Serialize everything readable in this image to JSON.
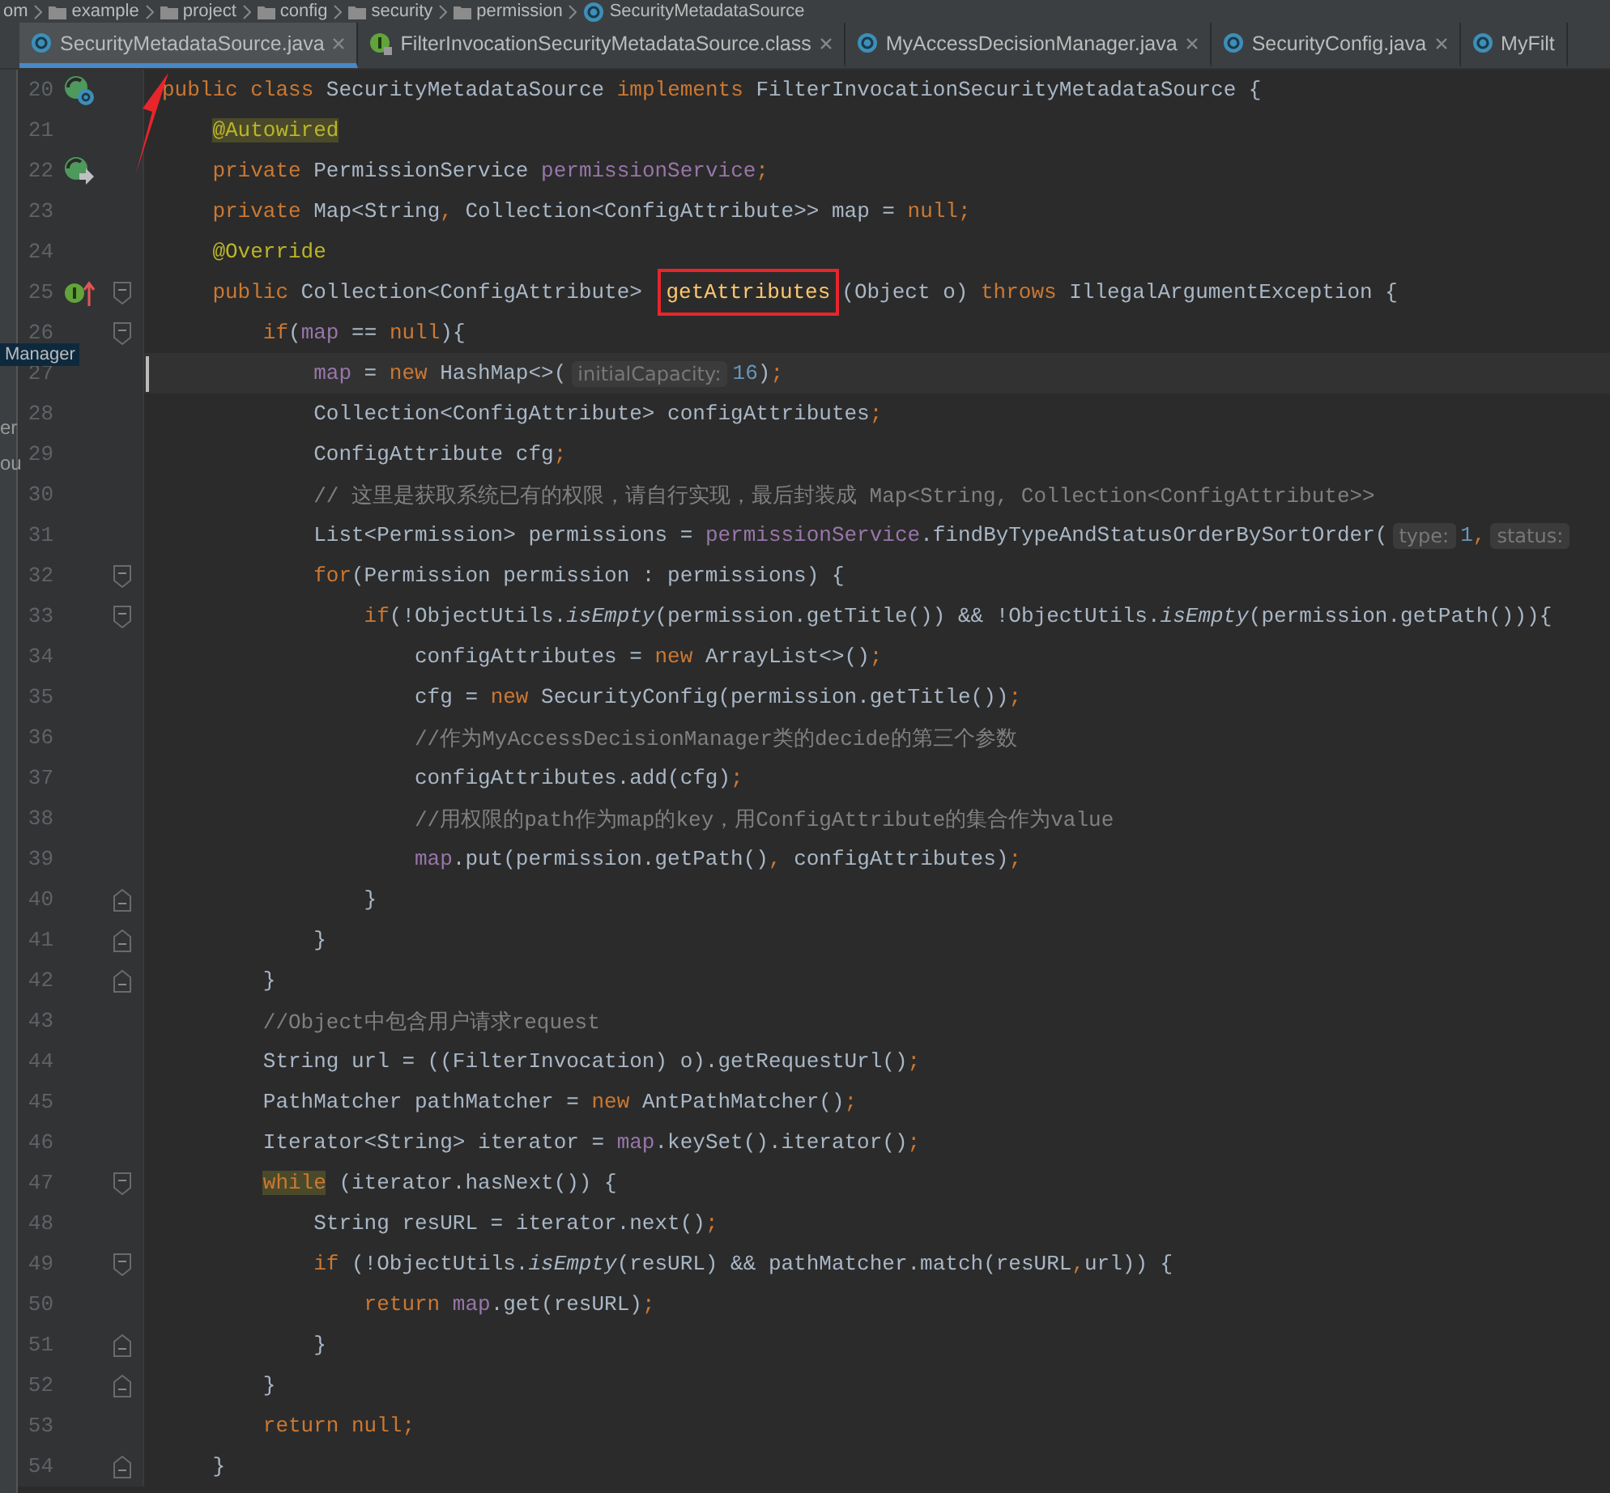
{
  "breadcrumb": [
    {
      "label": "om",
      "kind": "plain"
    },
    {
      "label": "example",
      "kind": "folder"
    },
    {
      "label": "project",
      "kind": "folder"
    },
    {
      "label": "config",
      "kind": "folder"
    },
    {
      "label": "security",
      "kind": "folder"
    },
    {
      "label": "permission",
      "kind": "folder"
    },
    {
      "label": "SecurityMetadataSource",
      "kind": "class"
    }
  ],
  "tabs": [
    {
      "label": "SecurityMetadataSource.java",
      "kind": "class",
      "selected": true,
      "closable": true
    },
    {
      "label": "FilterInvocationSecurityMetadataSource.class",
      "kind": "interface",
      "selected": false,
      "closable": true
    },
    {
      "label": "MyAccessDecisionManager.java",
      "kind": "class",
      "selected": false,
      "closable": true
    },
    {
      "label": "SecurityConfig.java",
      "kind": "class",
      "selected": false,
      "closable": true
    },
    {
      "label": "MyFilt",
      "kind": "class",
      "selected": false,
      "closable": false
    }
  ],
  "side_panel": {
    "fragments": [
      {
        "text": "Manager",
        "kind": "tooltip"
      },
      {
        "text": "er",
        "kind": "text"
      },
      {
        "text": "ou",
        "kind": "text"
      }
    ]
  },
  "lines": [
    {
      "number": "20",
      "kind": "class-impl",
      "tokens": [
        {
          "t": "public class ",
          "kind": "kw"
        },
        {
          "t": "SecurityMetadataSource ",
          "kind": "p"
        },
        {
          "t": "implements ",
          "kind": "kw"
        },
        {
          "t": "FilterInvocationSecurityMetadataSource {",
          "kind": "p"
        }
      ],
      "children": [
        {
          "number": "21",
          "tokens": [
            {
              "t": "@Autowired",
              "kind": "anno-mark"
            }
          ]
        },
        {
          "number": "22",
          "kind": "autowired",
          "tokens": [
            {
              "t": "private ",
              "kind": "kw"
            },
            {
              "t": "PermissionService ",
              "kind": "p"
            },
            {
              "t": "permissionService",
              "kind": "f"
            },
            {
              "t": ";",
              "kind": "pu"
            }
          ]
        },
        {
          "number": "23",
          "tokens": [
            {
              "t": "private ",
              "kind": "kw"
            },
            {
              "t": "Map<String",
              "kind": "p"
            },
            {
              "t": ", ",
              "kind": "pu"
            },
            {
              "t": "Collection<ConfigAttribute>> map = ",
              "kind": "p"
            },
            {
              "t": "null",
              "kind": "kw"
            },
            {
              "t": ";",
              "kind": "pu"
            }
          ]
        },
        {
          "number": "24",
          "tokens": [
            {
              "t": "@Override",
              "kind": "anno"
            }
          ]
        },
        {
          "number": "25",
          "kind": "implements",
          "fold": {
            "kind": "start"
          },
          "tokens": [
            {
              "t": "public ",
              "kind": "kw"
            },
            {
              "t": "Collection<ConfigAttribute> ",
              "kind": "p"
            },
            {
              "t": "getAttributes",
              "kind": "method-boxed"
            },
            {
              "t": "(Object o) ",
              "kind": "p"
            },
            {
              "t": "throws ",
              "kind": "kw"
            },
            {
              "t": "IllegalArgumentException {",
              "kind": "p"
            }
          ],
          "children": [
            {
              "number": "26",
              "fold": {
                "kind": "start"
              },
              "tokens": [
                {
                  "t": "if",
                  "kind": "kw"
                },
                {
                  "t": "(",
                  "kind": "p"
                },
                {
                  "t": "map",
                  "kind": "f"
                },
                {
                  "t": " == ",
                  "kind": "p"
                },
                {
                  "t": "null",
                  "kind": "kw"
                },
                {
                  "t": "){",
                  "kind": "p"
                }
              ],
              "children": [
                {
                  "number": "27",
                  "current": true,
                  "tokens": [
                    {
                      "t": "map",
                      "kind": "f"
                    },
                    {
                      "t": " = ",
                      "kind": "p"
                    },
                    {
                      "t": "new ",
                      "kind": "kw"
                    },
                    {
                      "t": "HashMap<>(",
                      "kind": "p"
                    },
                    {
                      "t": "initialCapacity:",
                      "kind": "hint"
                    },
                    {
                      "t": "16",
                      "kind": "num"
                    },
                    {
                      "t": ")",
                      "kind": "p"
                    },
                    {
                      "t": ";",
                      "kind": "pu"
                    }
                  ]
                },
                {
                  "number": "28",
                  "tokens": [
                    {
                      "t": "Collection<ConfigAttribute> configAttributes",
                      "kind": "p"
                    },
                    {
                      "t": ";",
                      "kind": "pu"
                    }
                  ]
                },
                {
                  "number": "29",
                  "tokens": [
                    {
                      "t": "ConfigAttribute cfg",
                      "kind": "p"
                    },
                    {
                      "t": ";",
                      "kind": "pu"
                    }
                  ]
                },
                {
                  "number": "30",
                  "tokens": [
                    {
                      "t": "// 这里是获取系统已有的权限，请自行实现，最后封装成 Map<String, Collection<ConfigAttribute>>",
                      "kind": "com"
                    }
                  ]
                },
                {
                  "number": "31",
                  "tokens": [
                    {
                      "t": "List<Permission> permissions = ",
                      "kind": "p"
                    },
                    {
                      "t": "permissionService",
                      "kind": "f"
                    },
                    {
                      "t": ".findByTypeAndStatusOrderBySortOrder(",
                      "kind": "p"
                    },
                    {
                      "t": "type:",
                      "kind": "hint"
                    },
                    {
                      "t": "1",
                      "kind": "num"
                    },
                    {
                      "t": ",",
                      "kind": "pu"
                    },
                    {
                      "t": "status:",
                      "kind": "hint"
                    }
                  ]
                },
                {
                  "number": "32",
                  "fold": {
                    "kind": "start"
                  },
                  "tokens": [
                    {
                      "t": "for",
                      "kind": "kw"
                    },
                    {
                      "t": "(Permission permission : permissions) {",
                      "kind": "p"
                    }
                  ],
                  "children": [
                    {
                      "number": "33",
                      "fold": {
                        "kind": "start"
                      },
                      "tokens": [
                        {
                          "t": "if",
                          "kind": "kw"
                        },
                        {
                          "t": "(!ObjectUtils.",
                          "kind": "p"
                        },
                        {
                          "t": "isEmpty",
                          "kind": "st"
                        },
                        {
                          "t": "(permission.getTitle()) && !ObjectUtils.",
                          "kind": "p"
                        },
                        {
                          "t": "isEmpty",
                          "kind": "st"
                        },
                        {
                          "t": "(permission.getPath())){",
                          "kind": "p"
                        }
                      ],
                      "children": [
                        {
                          "number": "34",
                          "tokens": [
                            {
                              "t": "configAttributes = ",
                              "kind": "p"
                            },
                            {
                              "t": "new ",
                              "kind": "kw"
                            },
                            {
                              "t": "ArrayList<>()",
                              "kind": "p"
                            },
                            {
                              "t": ";",
                              "kind": "pu"
                            }
                          ]
                        },
                        {
                          "number": "35",
                          "tokens": [
                            {
                              "t": "cfg = ",
                              "kind": "p"
                            },
                            {
                              "t": "new ",
                              "kind": "kw"
                            },
                            {
                              "t": "SecurityConfig(permission.getTitle())",
                              "kind": "p"
                            },
                            {
                              "t": ";",
                              "kind": "pu"
                            }
                          ]
                        },
                        {
                          "number": "36",
                          "tokens": [
                            {
                              "t": "//作为MyAccessDecisionManager类的decide的第三个参数",
                              "kind": "com"
                            }
                          ]
                        },
                        {
                          "number": "37",
                          "tokens": [
                            {
                              "t": "configAttributes.add(cfg)",
                              "kind": "p"
                            },
                            {
                              "t": ";",
                              "kind": "pu"
                            }
                          ]
                        },
                        {
                          "number": "38",
                          "tokens": [
                            {
                              "t": "//用权限的path作为map的key，用ConfigAttribute的集合作为value",
                              "kind": "com"
                            }
                          ]
                        },
                        {
                          "number": "39",
                          "tokens": [
                            {
                              "t": "map",
                              "kind": "f"
                            },
                            {
                              "t": ".put(permission.getPath()",
                              "kind": "p"
                            },
                            {
                              "t": ", ",
                              "kind": "pu"
                            },
                            {
                              "t": "configAttributes)",
                              "kind": "p"
                            },
                            {
                              "t": ";",
                              "kind": "pu"
                            }
                          ]
                        }
                      ]
                    },
                    {
                      "number": "40",
                      "fold": {
                        "kind": "end"
                      },
                      "tokens": [
                        {
                          "t": "}",
                          "kind": "p"
                        }
                      ]
                    }
                  ]
                },
                {
                  "number": "41",
                  "fold": {
                    "kind": "end"
                  },
                  "tokens": [
                    {
                      "t": "}",
                      "kind": "p"
                    }
                  ]
                }
              ]
            },
            {
              "number": "42",
              "fold": {
                "kind": "end"
              },
              "tokens": [
                {
                  "t": "}",
                  "kind": "p"
                }
              ]
            },
            {
              "number": "43",
              "tokens": [
                {
                  "t": "//Object中包含用户请求request",
                  "kind": "com"
                }
              ]
            },
            {
              "number": "44",
              "tokens": [
                {
                  "t": "String url = ((FilterInvocation) o).getRequestUrl()",
                  "kind": "p"
                },
                {
                  "t": ";",
                  "kind": "pu"
                }
              ]
            },
            {
              "number": "45",
              "tokens": [
                {
                  "t": "PathMatcher pathMatcher = ",
                  "kind": "p"
                },
                {
                  "t": "new ",
                  "kind": "kw"
                },
                {
                  "t": "AntPathMatcher()",
                  "kind": "p"
                },
                {
                  "t": ";",
                  "kind": "pu"
                }
              ]
            },
            {
              "number": "46",
              "tokens": [
                {
                  "t": "Iterator<String> iterator = ",
                  "kind": "p"
                },
                {
                  "t": "map",
                  "kind": "f"
                },
                {
                  "t": ".keySet().iterator()",
                  "kind": "p"
                },
                {
                  "t": ";",
                  "kind": "pu"
                }
              ]
            },
            {
              "number": "47",
              "fold": {
                "kind": "start"
              },
              "tokens": [
                {
                  "t": "while",
                  "kind": "kw-mark"
                },
                {
                  "t": " (iterator.hasNext()) {",
                  "kind": "p"
                }
              ],
              "children": [
                {
                  "number": "48",
                  "tokens": [
                    {
                      "t": "String resURL = iterator.next()",
                      "kind": "p"
                    },
                    {
                      "t": ";",
                      "kind": "pu"
                    }
                  ]
                },
                {
                  "number": "49",
                  "fold": {
                    "kind": "start"
                  },
                  "tokens": [
                    {
                      "t": "if ",
                      "kind": "kw"
                    },
                    {
                      "t": "(!ObjectUtils.",
                      "kind": "p"
                    },
                    {
                      "t": "isEmpty",
                      "kind": "st"
                    },
                    {
                      "t": "(resURL) && pathMatcher.match(resURL",
                      "kind": "p"
                    },
                    {
                      "t": ",",
                      "kind": "pu"
                    },
                    {
                      "t": "url)) {",
                      "kind": "p"
                    }
                  ],
                  "children": [
                    {
                      "number": "50",
                      "tokens": [
                        {
                          "t": "return ",
                          "kind": "kw"
                        },
                        {
                          "t": "map",
                          "kind": "f"
                        },
                        {
                          "t": ".get(resURL)",
                          "kind": "p"
                        },
                        {
                          "t": ";",
                          "kind": "pu"
                        }
                      ]
                    }
                  ]
                },
                {
                  "number": "51",
                  "fold": {
                    "kind": "end"
                  },
                  "tokens": [
                    {
                      "t": "}",
                      "kind": "p"
                    }
                  ]
                }
              ]
            },
            {
              "number": "52",
              "fold": {
                "kind": "end"
              },
              "tokens": [
                {
                  "t": "}",
                  "kind": "p"
                }
              ]
            },
            {
              "number": "53",
              "tokens": [
                {
                  "t": "return null",
                  "kind": "kw"
                },
                {
                  "t": ";",
                  "kind": "pu"
                }
              ]
            }
          ]
        },
        {
          "number": "54",
          "fold": {
            "kind": "end"
          },
          "tokens": [
            {
              "t": "}",
              "kind": "p"
            }
          ]
        }
      ]
    }
  ]
}
